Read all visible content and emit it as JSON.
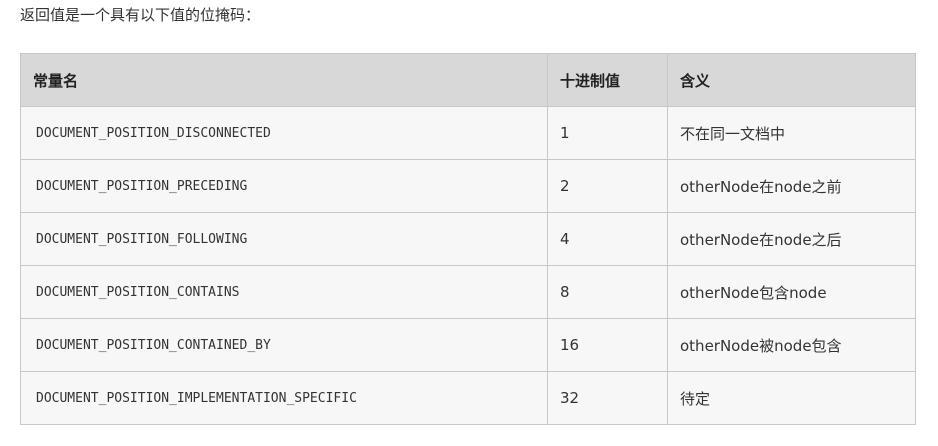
{
  "intro": {
    "text": "返回值是一个具有以下值的位掩码："
  },
  "table": {
    "headers": {
      "constant": "常量名",
      "decimal": "十进制值",
      "meaning": "含义"
    },
    "rows": [
      {
        "constant": "DOCUMENT_POSITION_DISCONNECTED",
        "decimal": "1",
        "meaning": "不在同一文档中"
      },
      {
        "constant": "DOCUMENT_POSITION_PRECEDING",
        "decimal": "2",
        "meaning": "otherNode在node之前"
      },
      {
        "constant": "DOCUMENT_POSITION_FOLLOWING",
        "decimal": "4",
        "meaning": "otherNode在node之后"
      },
      {
        "constant": "DOCUMENT_POSITION_CONTAINS",
        "decimal": "8",
        "meaning": "otherNode包含node"
      },
      {
        "constant": "DOCUMENT_POSITION_CONTAINED_BY",
        "decimal": "16",
        "meaning": "otherNode被node包含"
      },
      {
        "constant": "DOCUMENT_POSITION_IMPLEMENTATION_SPECIFIC",
        "decimal": "32",
        "meaning": "待定"
      }
    ]
  },
  "colors": {
    "header_background": "#d8d8d8",
    "row_background": "#f7f7f7",
    "border": "#c8c8c8",
    "text": "#333333"
  }
}
